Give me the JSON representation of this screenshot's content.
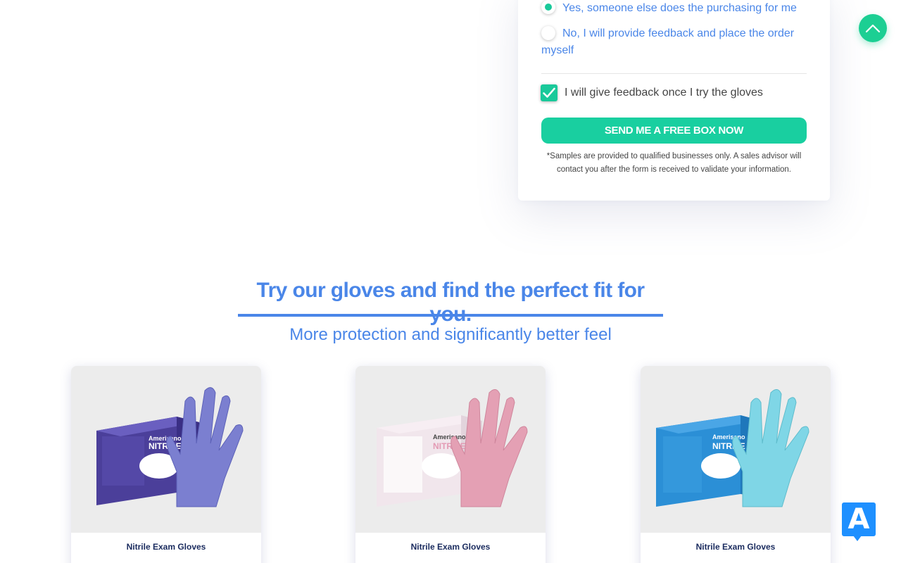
{
  "form": {
    "radio_options": [
      {
        "label": "Yes, someone else does the purchasing for me",
        "selected": true
      },
      {
        "label": "No, I will provide feedback and place the order myself",
        "selected": false
      }
    ],
    "checkbox": {
      "label": "I will give feedback once I try the gloves",
      "checked": true
    },
    "submit_label": "SEND ME A FREE BOX NOW",
    "disclaimer": "*Samples are provided to qualified businesses only. A sales advisor will contact you after the form is received to validate your information."
  },
  "section": {
    "title": "Try our gloves and find the perfect fit for you.",
    "subtitle": "More protection and significantly better feel"
  },
  "products": [
    {
      "name": "Nitrile Exam Gloves",
      "brand": "Amerisano",
      "product_line": "NITRILE G",
      "glove_color": "#7b7fd0",
      "box_color": "#4b3f9a"
    },
    {
      "name": "Nitrile Exam Gloves",
      "brand": "Amerisano",
      "product_line": "NITRILE G",
      "glove_color": "#e4a0b4",
      "box_color": "#f1e6ec"
    },
    {
      "name": "Nitrile Exam Gloves",
      "brand": "Amerisano",
      "product_line": "NITRILE G",
      "glove_color": "#7fd6e6",
      "box_color": "#2b8fd6"
    }
  ],
  "colors": {
    "accent_green": "#19cfa0",
    "accent_blue": "#4a86e8",
    "a11y_blue": "#1e90ff"
  },
  "icons": {
    "scroll_top": "chevron-up-icon",
    "accessibility": "accessibility-icon"
  },
  "accessibility": {
    "letter": "A"
  }
}
